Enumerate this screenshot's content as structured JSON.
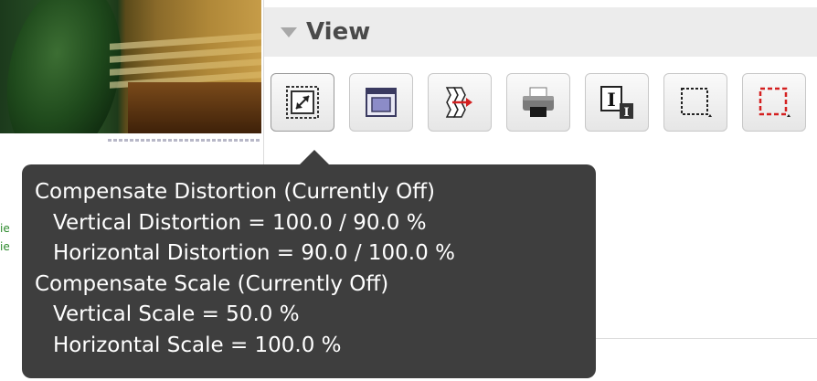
{
  "panel": {
    "title": "View"
  },
  "left_preview": {
    "fragments": [
      "ie",
      "ie"
    ]
  },
  "toolbar": {
    "buttons": [
      {
        "name": "compensate-distortion",
        "icon": "resize-arrow-icon"
      },
      {
        "name": "window-view",
        "icon": "window-icon"
      },
      {
        "name": "film-swap",
        "icon": "film-arrow-icon"
      },
      {
        "name": "print",
        "icon": "printer-icon"
      },
      {
        "name": "text-size",
        "icon": "text-cursor-icon"
      },
      {
        "name": "crop-frame",
        "icon": "dashed-frame-icon"
      },
      {
        "name": "red-crop-frame",
        "icon": "red-dashed-frame-icon"
      }
    ]
  },
  "tooltip": {
    "heading1": "Compensate Distortion (Currently Off)",
    "vertical_distortion": "Vertical Distortion = 100.0 / 90.0 %",
    "horizontal_distortion": "Horizontal Distortion = 90.0 / 100.0 %",
    "heading2": "Compensate Scale (Currently Off)",
    "vertical_scale": "Vertical Scale = 50.0 %",
    "horizontal_scale": "Horizontal Scale = 100.0 %"
  },
  "colors": {
    "tooltip_bg": "#3e3e3e",
    "header_bg": "#ececec",
    "accent_red": "#d42020"
  }
}
